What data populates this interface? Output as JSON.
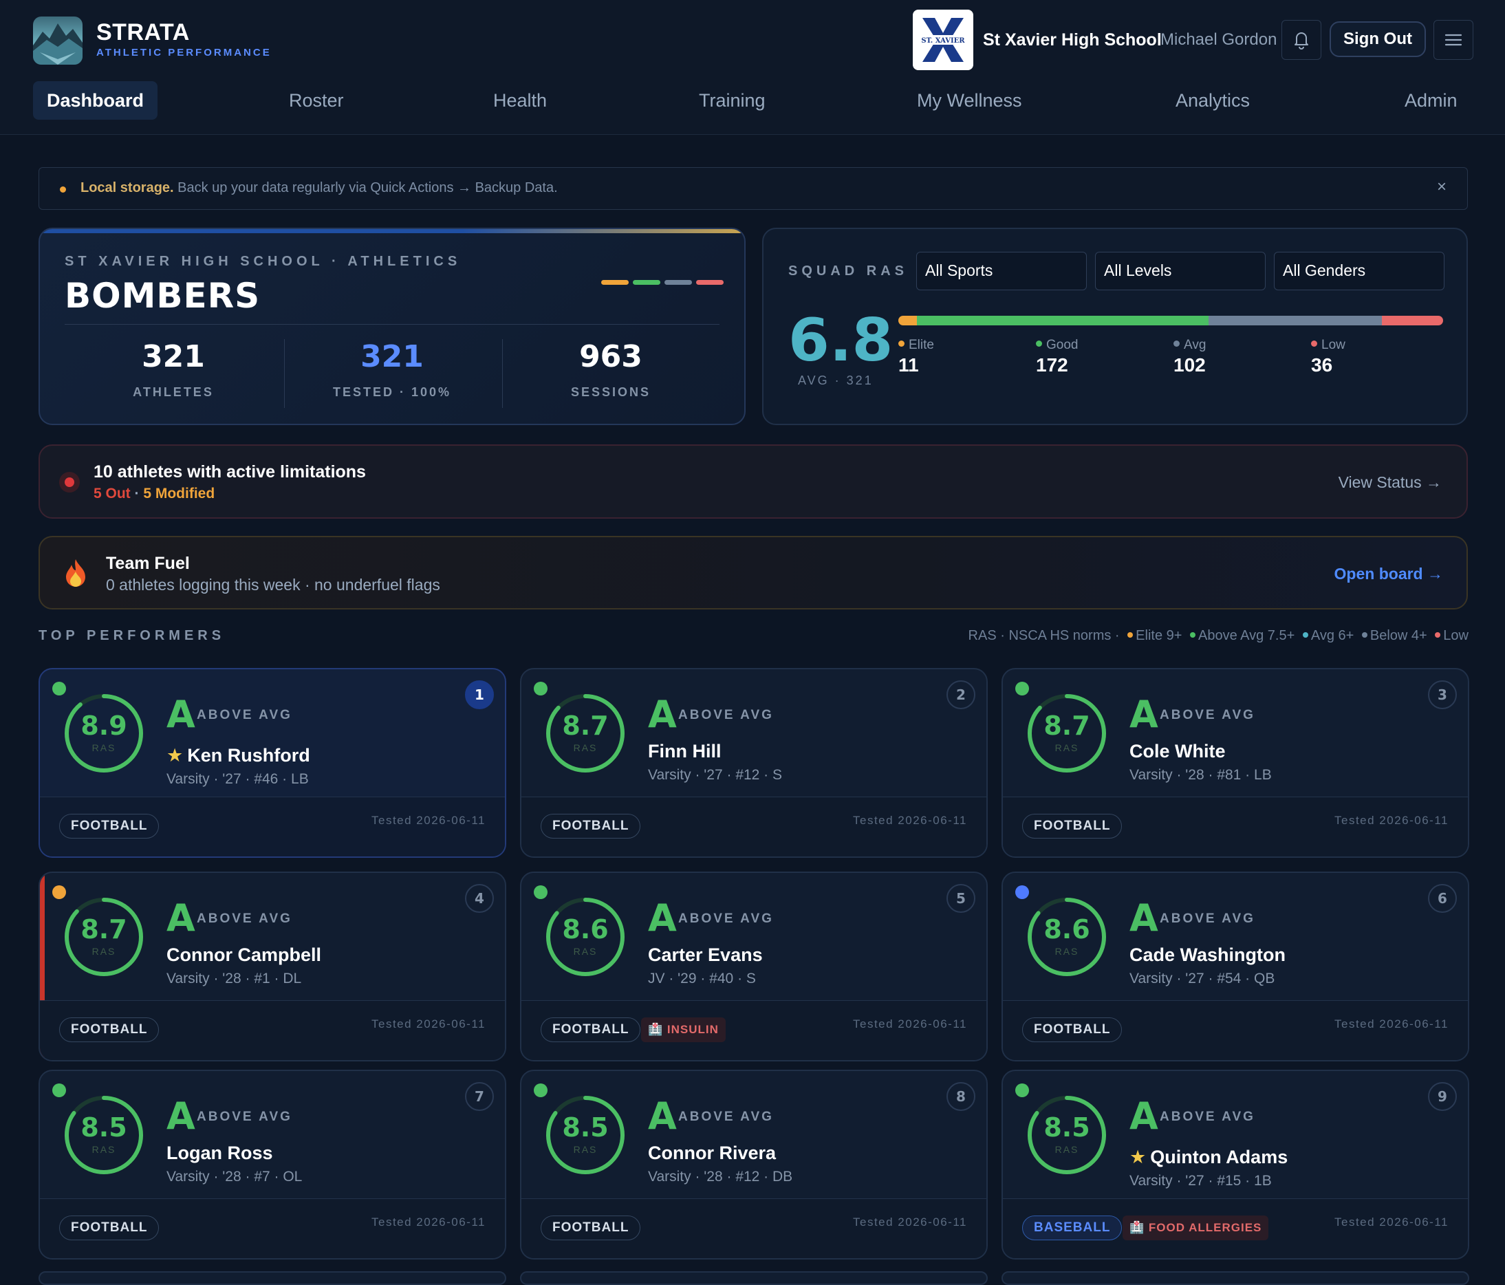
{
  "brand": {
    "name": "STRATA",
    "subtitle": "ATHLETIC PERFORMANCE"
  },
  "header": {
    "school_name": "St Xavier High School",
    "school_logo_text": "ST. XAVIER",
    "user_name": "Michael Gordon",
    "bell_icon": "bell-icon",
    "sign_out_label": "Sign Out",
    "menu_icon": "hamburger-menu-icon"
  },
  "nav": [
    {
      "label": "Dashboard",
      "active": true
    },
    {
      "label": "Roster"
    },
    {
      "label": "Health"
    },
    {
      "label": "Training"
    },
    {
      "label": "My Wellness"
    },
    {
      "label": "Analytics"
    },
    {
      "label": "Admin"
    }
  ],
  "banner": {
    "bold": "Local storage.",
    "text": " Back up your data regularly via Quick Actions → Backup Data.",
    "close": "×"
  },
  "team": {
    "kicker": "ST XAVIER HIGH SCHOOL · ATHLETICS",
    "name": "BOMBERS",
    "stats": [
      {
        "value": "321",
        "label": "ATHLETES",
        "color": "#ffffff"
      },
      {
        "value": "321",
        "label": "TESTED · 100%",
        "color": "#5b8cff"
      },
      {
        "value": "963",
        "label": "SESSIONS",
        "color": "#ffffff"
      }
    ]
  },
  "squad": {
    "kicker": "SQUAD RAS",
    "filters": [
      "All Sports",
      "All Levels",
      "All Genders"
    ],
    "avg": "6.8",
    "avg_sub": "AVG · 321",
    "tiers": [
      {
        "label": "Elite",
        "value": "11",
        "color": "#f0a43a"
      },
      {
        "label": "Good",
        "value": "172",
        "color": "#4bbf63"
      },
      {
        "label": "Avg",
        "value": "102",
        "color": "#6f8299"
      },
      {
        "label": "Low",
        "value": "36",
        "color": "#e96a6a"
      }
    ]
  },
  "limitations": {
    "title": "10 athletes with active limitations",
    "out": "5 Out",
    "sep": " · ",
    "modified": "5 Modified",
    "link": "View Status →"
  },
  "fuel": {
    "title": "Team Fuel",
    "sub": "0 athletes logging this week · no underfuel flags",
    "link": "Open board →"
  },
  "top": {
    "title": "TOP PERFORMERS",
    "legend_prefix": "RAS · NSCA HS norms ·",
    "legend": [
      {
        "label": "Elite 9+",
        "color": "#f0a43a"
      },
      {
        "label": "Above Avg 7.5+",
        "color": "#4bbf63"
      },
      {
        "label": "Avg 6+",
        "color": "#4eb4c6"
      },
      {
        "label": "Below 4+",
        "color": "#6f8299"
      },
      {
        "label": "Low",
        "color": "#e96a6a"
      }
    ]
  },
  "performers": [
    {
      "rank": "1",
      "score": "8.9",
      "score_fraction": 0.89,
      "ras": "RAS",
      "grade": "A",
      "tier": "ABOVE AVG",
      "star": true,
      "name": "Ken Rushford",
      "meta": "Varsity · '27 · #46 · LB",
      "sport": "FOOTBALL",
      "tested": "Tested 2026-06-11",
      "status": "#4bbf63"
    },
    {
      "rank": "2",
      "score": "8.7",
      "score_fraction": 0.87,
      "ras": "RAS",
      "grade": "A",
      "tier": "ABOVE AVG",
      "star": false,
      "name": "Finn Hill",
      "meta": "Varsity · '27 · #12 · S",
      "sport": "FOOTBALL",
      "tested": "Tested 2026-06-11",
      "status": "#4bbf63"
    },
    {
      "rank": "3",
      "score": "8.7",
      "score_fraction": 0.87,
      "ras": "RAS",
      "grade": "A",
      "tier": "ABOVE AVG",
      "star": false,
      "name": "Cole White",
      "meta": "Varsity · '28 · #81 · LB",
      "sport": "FOOTBALL",
      "tested": "Tested 2026-06-11",
      "status": "#4bbf63"
    },
    {
      "rank": "4",
      "score": "8.7",
      "score_fraction": 0.87,
      "ras": "RAS",
      "grade": "A",
      "tier": "ABOVE AVG",
      "star": false,
      "name": "Connor Campbell",
      "meta": "Varsity · '28 · #1 · DL",
      "sport": "FOOTBALL",
      "tested": "Tested 2026-06-11",
      "status": "#f0a43a",
      "limited": true
    },
    {
      "rank": "5",
      "score": "8.6",
      "score_fraction": 0.86,
      "ras": "RAS",
      "grade": "A",
      "tier": "ABOVE AVG",
      "star": false,
      "name": "Carter Evans",
      "meta": "JV · '29 · #40 · S",
      "sport": "FOOTBALL",
      "medical": "INSULIN",
      "tested": "Tested 2026-06-11",
      "status": "#4bbf63"
    },
    {
      "rank": "6",
      "score": "8.6",
      "score_fraction": 0.86,
      "ras": "RAS",
      "grade": "A",
      "tier": "ABOVE AVG",
      "star": false,
      "name": "Cade Washington",
      "meta": "Varsity · '27 · #54 · QB",
      "sport": "FOOTBALL",
      "tested": "Tested 2026-06-11",
      "status": "#4f7bff"
    },
    {
      "rank": "7",
      "score": "8.5",
      "score_fraction": 0.85,
      "ras": "RAS",
      "grade": "A",
      "tier": "ABOVE AVG",
      "star": false,
      "name": "Logan Ross",
      "meta": "Varsity · '28 · #7 · OL",
      "sport": "FOOTBALL",
      "tested": "Tested 2026-06-11",
      "status": "#4bbf63"
    },
    {
      "rank": "8",
      "score": "8.5",
      "score_fraction": 0.85,
      "ras": "RAS",
      "grade": "A",
      "tier": "ABOVE AVG",
      "star": false,
      "name": "Connor Rivera",
      "meta": "Varsity · '28 · #12 · DB",
      "sport": "FOOTBALL",
      "tested": "Tested 2026-06-11",
      "status": "#4bbf63"
    },
    {
      "rank": "9",
      "score": "8.5",
      "score_fraction": 0.85,
      "ras": "RAS",
      "grade": "A",
      "tier": "ABOVE AVG",
      "star": true,
      "name": "Quinton Adams",
      "meta": "Varsity · '27 · #15 · 1B",
      "sport": "BASEBALL",
      "medical": "FOOD ALLERGIES",
      "tested": "Tested 2026-06-11",
      "status": "#4bbf63"
    }
  ]
}
